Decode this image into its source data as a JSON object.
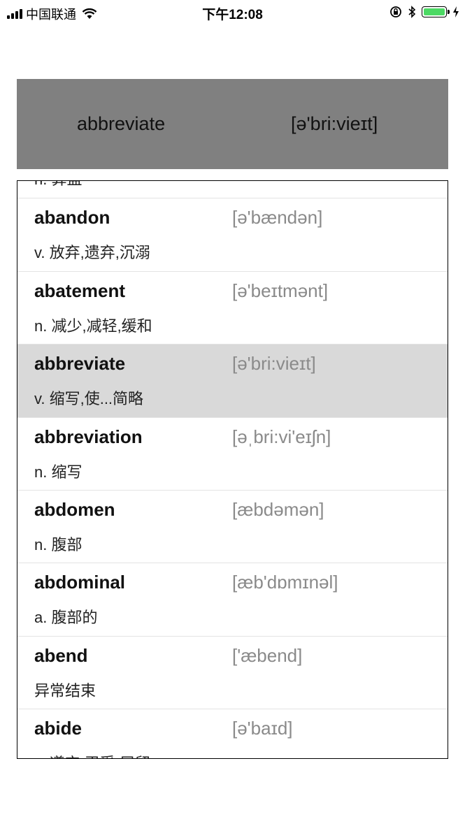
{
  "status_bar": {
    "carrier": "中国联通",
    "time": "下午12:08",
    "icons": [
      "signal-icon",
      "wifi-icon",
      "rotation-lock-icon",
      "bluetooth-icon",
      "battery-icon",
      "charging-icon"
    ]
  },
  "selected": {
    "word": "abbreviate",
    "phonetic": "[ə'bri:vieɪt]"
  },
  "list": {
    "rows": [
      {
        "word": "",
        "phonetic": "",
        "definition": "n. 算盘"
      },
      {
        "word": "abandon",
        "phonetic": "[ə'bændən]",
        "definition": "v. 放弃,遗弃,沉溺"
      },
      {
        "word": "abatement",
        "phonetic": "[ə'beɪtmənt]",
        "definition": "n. 减少,减轻,缓和"
      },
      {
        "word": "abbreviate",
        "phonetic": "[ə'bri:vieɪt]",
        "definition": "v. 缩写,使...简略"
      },
      {
        "word": "abbreviation",
        "phonetic": "[əˌbri:vi'eɪʃn]",
        "definition": "n. 缩写"
      },
      {
        "word": "abdomen",
        "phonetic": "[æbdəmən]",
        "definition": "n. 腹部"
      },
      {
        "word": "abdominal",
        "phonetic": "[æb'dɒmɪnəl]",
        "definition": "a. 腹部的"
      },
      {
        "word": "abend",
        "phonetic": "['æbend]",
        "definition": "异常结束"
      },
      {
        "word": "abide",
        "phonetic": "[ə'baɪd]",
        "definition": "v. 遵守,忍受,居留"
      }
    ]
  },
  "colors": {
    "header_bg": "#808080",
    "selected_row_bg": "#d9d9d9",
    "phonetic_text": "#8a8a8a",
    "battery": "#4cd964"
  }
}
